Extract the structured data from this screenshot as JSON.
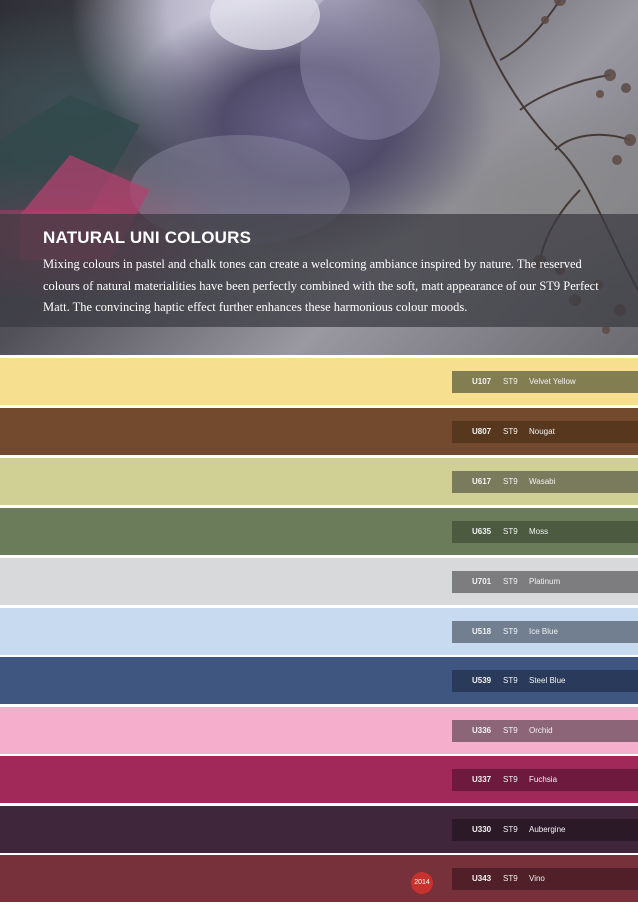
{
  "header": {
    "title": "NATURAL UNI COLOURS",
    "description": "Mixing colours in pastel and chalk tones can create a welcoming ambiance inspired by nature. The reserved colours of natural materialities have been perfectly combined with the soft, matt appearance of our ST9 Perfect Matt. The convincing haptic effect further enhances these harmonious colour moods."
  },
  "swatches": [
    {
      "code": "U107",
      "finish": "ST9",
      "name": "Velvet Yellow",
      "color": "#f6df8f",
      "tag_color": "#837d52"
    },
    {
      "code": "U807",
      "finish": "ST9",
      "name": "Nougat",
      "color": "#744a2f",
      "tag_color": "#57381f"
    },
    {
      "code": "U617",
      "finish": "ST9",
      "name": "Wasabi",
      "color": "#d0d095",
      "tag_color": "#7a7b5c"
    },
    {
      "code": "U635",
      "finish": "ST9",
      "name": "Moss",
      "color": "#6b7c5b",
      "tag_color": "#4c5a40"
    },
    {
      "code": "U701",
      "finish": "ST9",
      "name": "Platinum",
      "color": "#d8d9da",
      "tag_color": "#7d7d7f"
    },
    {
      "code": "U518",
      "finish": "ST9",
      "name": "Ice Blue",
      "color": "#c8daf0",
      "tag_color": "#727f90"
    },
    {
      "code": "U539",
      "finish": "ST9",
      "name": "Steel Blue",
      "color": "#3e5680",
      "tag_color": "#2a3a5b"
    },
    {
      "code": "U336",
      "finish": "ST9",
      "name": "Orchid",
      "color": "#f5aecb",
      "tag_color": "#8c6678"
    },
    {
      "code": "U337",
      "finish": "ST9",
      "name": "Fuchsia",
      "color": "#a0295a",
      "tag_color": "#6e1a3e"
    },
    {
      "code": "U330",
      "finish": "ST9",
      "name": "Aubergine",
      "color": "#3f263a",
      "tag_color": "#2b1928"
    },
    {
      "code": "U343",
      "finish": "ST9",
      "name": "Vino",
      "color": "#76313a",
      "tag_color": "#511f28"
    }
  ],
  "year_badge": "2014"
}
